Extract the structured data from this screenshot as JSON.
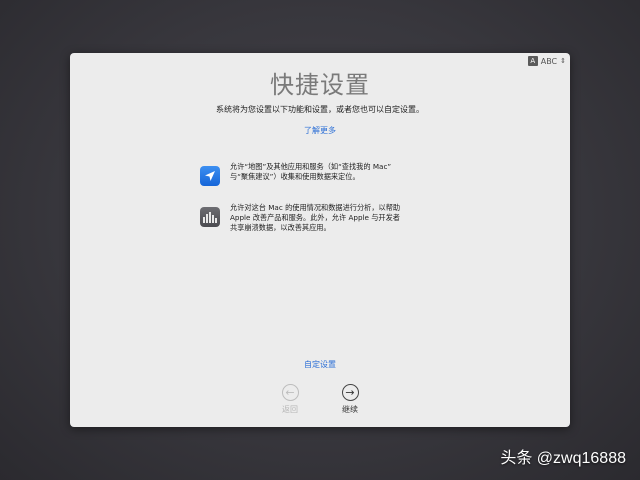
{
  "input_menu": {
    "icon_letter": "A",
    "label": "ABC",
    "chevron": "⌃"
  },
  "title": "快捷设置",
  "subtitle": "系统将为您设置以下功能和设置，或者您也可以自定设置。",
  "learn_more": "了解更多",
  "options": [
    {
      "icon": "location-arrow-icon",
      "lines": [
        "允许“地图”及其他应用和服务（如“查找我的 Mac”",
        "与“聚焦建议”）收集和使用数据来定位。"
      ]
    },
    {
      "icon": "analytics-bars-icon",
      "lines": [
        "允许对这台 Mac 的使用情况和数据进行分析，以帮助",
        "Apple 改善产品和服务。此外，允许 Apple 与开发者",
        "共享崩溃数据，以改善其应用。"
      ]
    }
  ],
  "customize": "自定设置",
  "nav": {
    "back_label": "返回",
    "next_label": "继续"
  },
  "watermark": "头条 @zwq16888",
  "colors": {
    "link": "#2c6fd6",
    "background": "#38373d",
    "panel": "#ececec"
  }
}
